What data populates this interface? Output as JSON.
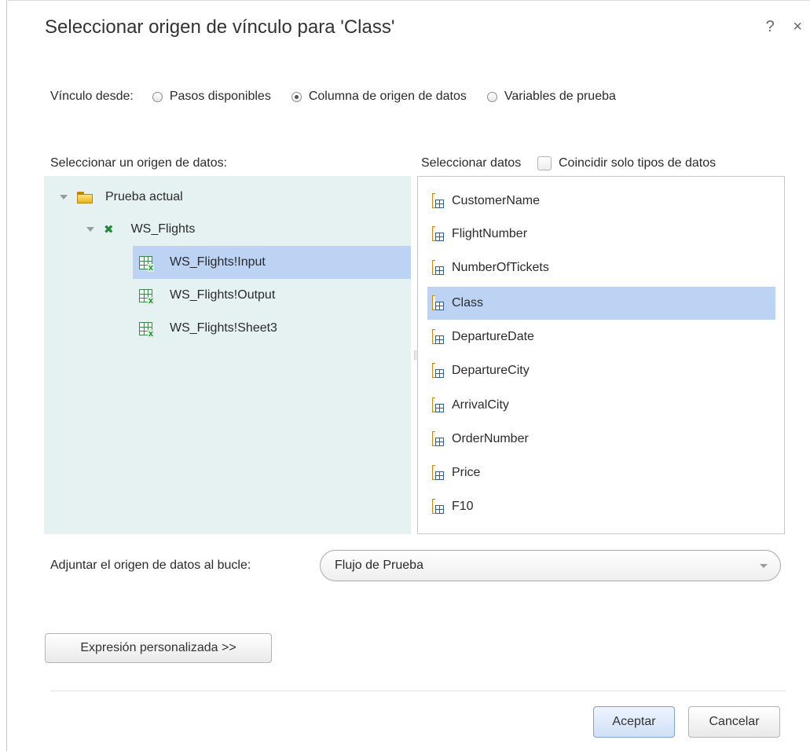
{
  "dialog": {
    "title": "Seleccionar origen de vínculo para 'Class'",
    "help_label": "?",
    "close_label": "×"
  },
  "link_from": {
    "label": "Vínculo desde:",
    "options": [
      {
        "label": "Pasos disponibles",
        "checked": false
      },
      {
        "label": "Columna de origen de datos",
        "checked": true
      },
      {
        "label": "Variables de prueba",
        "checked": false
      }
    ]
  },
  "data_source_panel": {
    "label": "Seleccionar un origen de datos:",
    "tree": {
      "root": "Prueba actual",
      "child": "WS_Flights",
      "sheets": [
        "WS_Flights!Input",
        "WS_Flights!Output",
        "WS_Flights!Sheet3"
      ],
      "selected_sheet": "WS_Flights!Input"
    }
  },
  "data_panel": {
    "label": "Seleccionar datos",
    "match_types_label": "Coincidir solo tipos de datos",
    "match_types_checked": false,
    "columns": [
      "CustomerName",
      "FlightNumber",
      "NumberOfTickets",
      "Class",
      "DepartureDate",
      "DepartureCity",
      "ArrivalCity",
      "OrderNumber",
      "Price",
      "F10"
    ],
    "selected_column": "Class"
  },
  "attach": {
    "label": "Adjuntar el origen de datos al bucle:",
    "value": "Flujo de Prueba"
  },
  "buttons": {
    "custom_expression": "Expresión personalizada >>",
    "ok": "Aceptar",
    "cancel": "Cancelar"
  },
  "colors": {
    "tree_background": "#e6f1f1",
    "selection": "#bcd3f3"
  }
}
